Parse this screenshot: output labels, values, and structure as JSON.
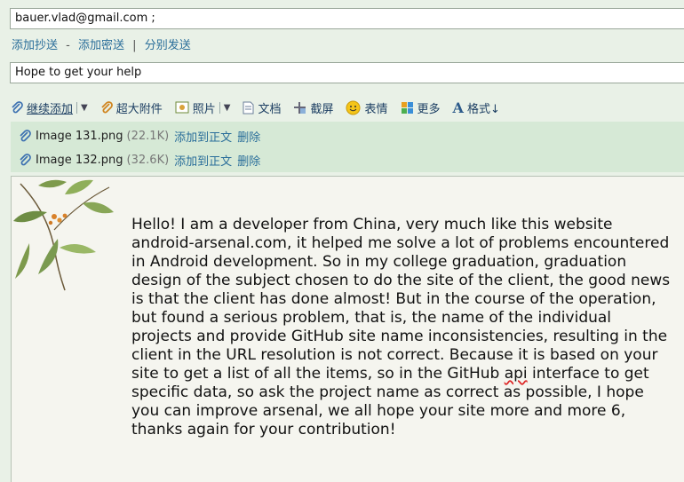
{
  "recipient": {
    "value": "bauer.vlad@gmail.com ;"
  },
  "recipient_links": {
    "add_cc": "添加抄送",
    "dash": "-",
    "add_bcc": "添加密送",
    "divider": "|",
    "send_separately": "分别发送"
  },
  "subject": {
    "value": "Hope to get your help"
  },
  "toolbar": {
    "continue_add": "继续添加",
    "large_attachment": "超大附件",
    "photo": "照片",
    "document": "文档",
    "screenshot": "截屏",
    "emoji": "表情",
    "more": "更多",
    "format": "格式↓"
  },
  "attachments": [
    {
      "name": "Image 131.png",
      "size": "(22.1K)",
      "add_to_body": "添加到正文",
      "delete": "删除"
    },
    {
      "name": "Image 132.png",
      "size": "(32.6K)",
      "add_to_body": "添加到正文",
      "delete": "删除"
    }
  ],
  "body": {
    "text_1": "Hello! I am a developer from China, very much like this website android-arsenal.com, it helped me solve a lot of problems encountered in Android development. So in my college graduation, graduation design of the subject chosen to do the site of the client, the good news is that the client has done almost! But in the course of the operation, but found a serious problem, that is, the name of the individual projects and provide GitHub site name inconsistencies, resulting in the client in the URL resolution is not correct. Because it is based on your site to get a list of all the items, so in the GitHub ",
    "misspelled_word": "api",
    "text_2": "  interface to get specific data, so ask the project name as correct as possible, I hope you can improve arsenal, we all hope your site more and more 6, thanks again for your contribution!"
  },
  "colors": {
    "background": "#e9f1e7",
    "link": "#2a6e9a",
    "attachment_panel": "#d6e9d6",
    "body_background": "#f5f5ef"
  }
}
